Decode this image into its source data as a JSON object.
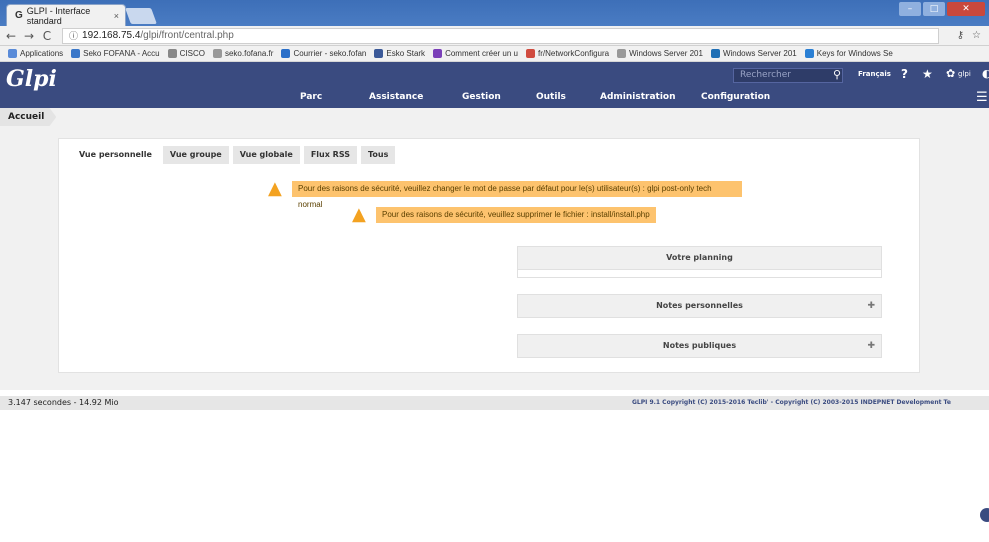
{
  "browser": {
    "tab_title": "GLPI - Interface standard",
    "tab_close": "×",
    "url_host": "192.168.75.4",
    "url_path": "/glpi/front/central.php",
    "bookmarks": [
      {
        "label": "Applications",
        "color": "#5a8bd8"
      },
      {
        "label": "Seko FOFANA - Accu",
        "color": "#3b78c9"
      },
      {
        "label": "CISCO",
        "color": "#888888"
      },
      {
        "label": "seko.fofana.fr",
        "color": "#999999"
      },
      {
        "label": "Courrier - seko.fofan",
        "color": "#2a6fc9"
      },
      {
        "label": "Esko Stark",
        "color": "#3b5998"
      },
      {
        "label": "Comment créer un u",
        "color": "#7a3fb8"
      },
      {
        "label": "fr/NetworkConfigura",
        "color": "#d04b3f"
      },
      {
        "label": "Windows Server 201",
        "color": "#999999"
      },
      {
        "label": "Windows Server 201",
        "color": "#1f6fb5"
      },
      {
        "label": "Keys for Windows Se",
        "color": "#2a7fd4"
      }
    ]
  },
  "header": {
    "logo": "Glpi",
    "search_placeholder": "Rechercher",
    "language": "Français",
    "user": "glpi",
    "menu": [
      "Parc",
      "Assistance",
      "Gestion",
      "Outils",
      "Administration",
      "Configuration"
    ]
  },
  "breadcrumb": "Accueil",
  "tabs": [
    "Vue personnelle",
    "Vue groupe",
    "Vue globale",
    "Flux RSS",
    "Tous"
  ],
  "warnings": [
    "Pour des raisons de sécurité, veuillez changer le mot de passe par défaut pour le(s) utilisateur(s) : glpi post-only tech normal",
    "Pour des raisons de sécurité, veuillez supprimer le fichier : install/install.php"
  ],
  "boxes": {
    "planning": "Votre planning",
    "personal_notes": "Notes personnelles",
    "public_notes": "Notes publiques"
  },
  "footer": {
    "timing": "3.147 secondes - 14.92 Mio",
    "copyright": "GLPI 9.1 Copyright (C) 2015-2016 Teclib' - Copyright (C) 2003-2015 INDEPNET Development Te"
  },
  "colors": {
    "header_bg": "#3a4b80",
    "warning_bg": "#fdc36e",
    "warning_icon": "#f3a221"
  }
}
